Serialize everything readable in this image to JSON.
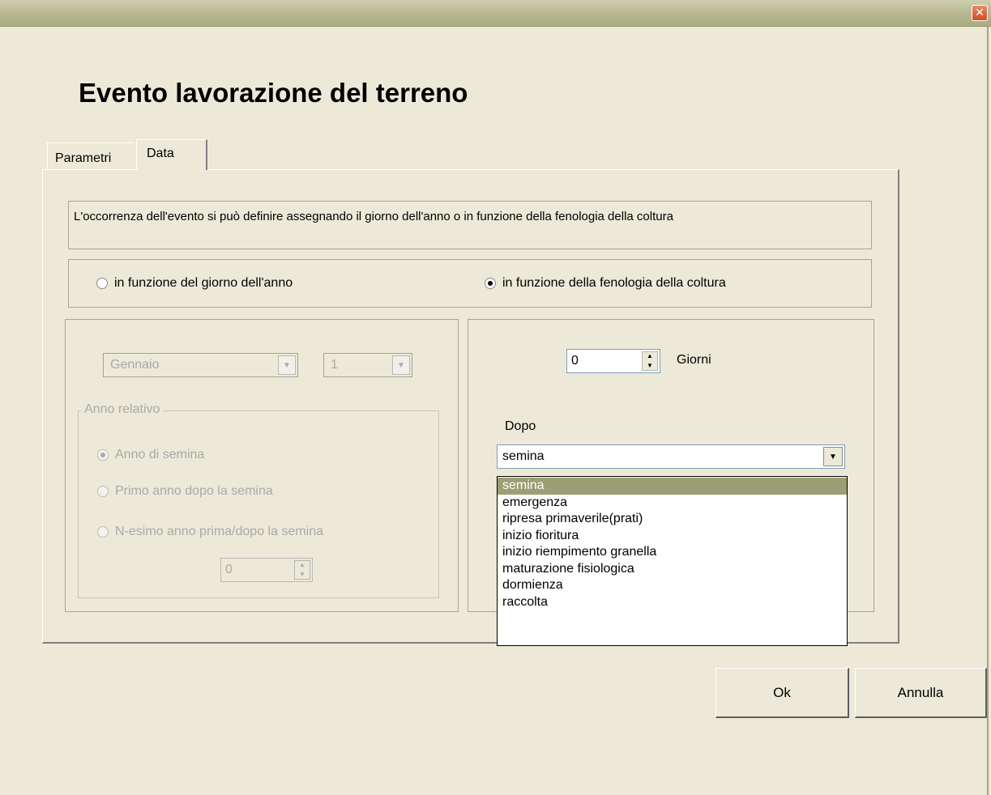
{
  "window": {
    "close_glyph": "✕"
  },
  "dialog": {
    "title": "Evento lavorazione del terreno"
  },
  "tabs": [
    {
      "label": "Parametri",
      "active": false
    },
    {
      "label": "Data",
      "active": true
    }
  ],
  "info": {
    "text": "L'occorrenza dell'evento si può definire assegnando il giorno dell'anno o in funzione della fenologia della coltura"
  },
  "mode": {
    "options": [
      {
        "label": "in funzione del giorno dell'anno",
        "checked": false
      },
      {
        "label": "in funzione della fenologia della coltura",
        "checked": true
      }
    ]
  },
  "date_panel": {
    "month": "Gennaio",
    "day": "1",
    "relative_year": {
      "label": "Anno relativo",
      "options": [
        {
          "label": "Anno di semina",
          "checked": true
        },
        {
          "label": "Primo anno dopo la semina",
          "checked": false
        },
        {
          "label": "N-esimo anno prima/dopo la semina",
          "checked": false
        }
      ],
      "n_value": "0"
    }
  },
  "phenology_panel": {
    "days_value": "0",
    "days_label": "Giorni",
    "after_label": "Dopo",
    "selected": "semina",
    "options": [
      "semina",
      "emergenza",
      "ripresa primaverile(prati)",
      "inizio fioritura",
      "inizio riempimento granella",
      "maturazione fisiologica",
      "dormienza",
      "raccolta"
    ]
  },
  "buttons": {
    "ok": "Ok",
    "cancel": "Annulla"
  }
}
